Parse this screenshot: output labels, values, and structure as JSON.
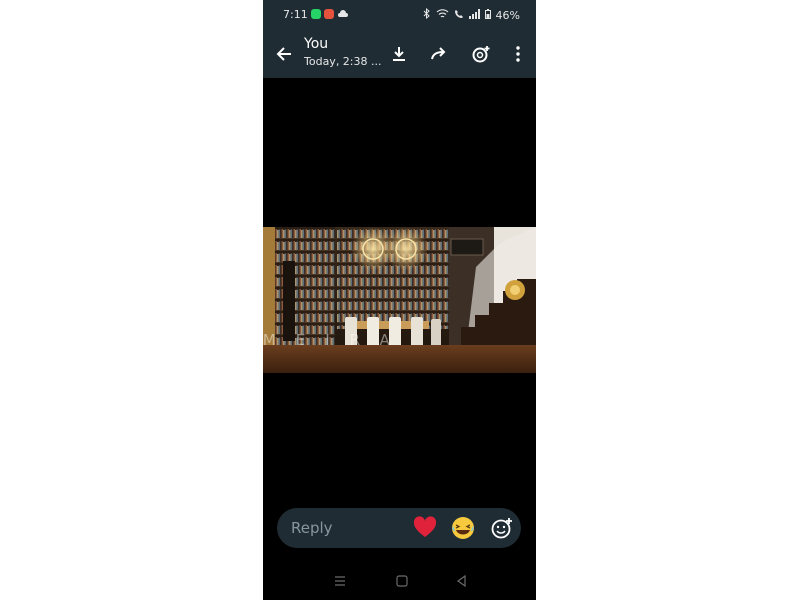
{
  "status_bar": {
    "time": "7:11",
    "battery": "46%"
  },
  "header": {
    "title": "You",
    "subtitle": "Today, 2:38 ..."
  },
  "watermark": {
    "text": "LIMEIRA"
  },
  "reply": {
    "placeholder": "Reply"
  },
  "colors": {
    "header_bg": "#1f2c34",
    "reply_bg": "#1f2c34",
    "heart": "#e0233a",
    "emoji_face": "#f7c93e"
  }
}
